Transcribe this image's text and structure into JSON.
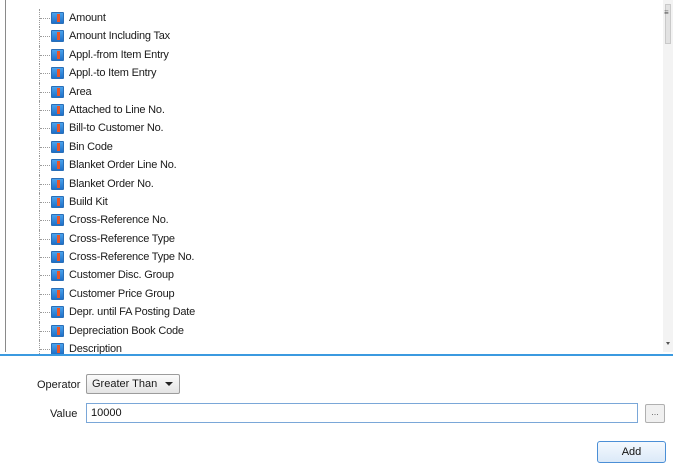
{
  "fields": [
    {
      "label": "Amount"
    },
    {
      "label": "Amount Including Tax"
    },
    {
      "label": "Appl.-from Item Entry"
    },
    {
      "label": "Appl.-to Item Entry"
    },
    {
      "label": "Area"
    },
    {
      "label": "Attached to Line No."
    },
    {
      "label": "Bill-to Customer No."
    },
    {
      "label": "Bin Code"
    },
    {
      "label": "Blanket Order Line No."
    },
    {
      "label": "Blanket Order No."
    },
    {
      "label": "Build Kit"
    },
    {
      "label": "Cross-Reference No."
    },
    {
      "label": "Cross-Reference Type"
    },
    {
      "label": "Cross-Reference Type No."
    },
    {
      "label": "Customer Disc. Group"
    },
    {
      "label": "Customer Price Group"
    },
    {
      "label": "Depr. until FA Posting Date"
    },
    {
      "label": "Depreciation Book Code"
    },
    {
      "label": "Description"
    }
  ],
  "field_icon": "field-icon",
  "filter": {
    "operator_label": "Operator",
    "operator_value": "Greater Than",
    "value_label": "Value",
    "value": "10000",
    "lookup_label": "...",
    "add_label": "Add"
  },
  "colors": {
    "accent": "#3b9ae0",
    "icon_blue": "#2f86d8",
    "icon_orange": "#e8552a"
  }
}
